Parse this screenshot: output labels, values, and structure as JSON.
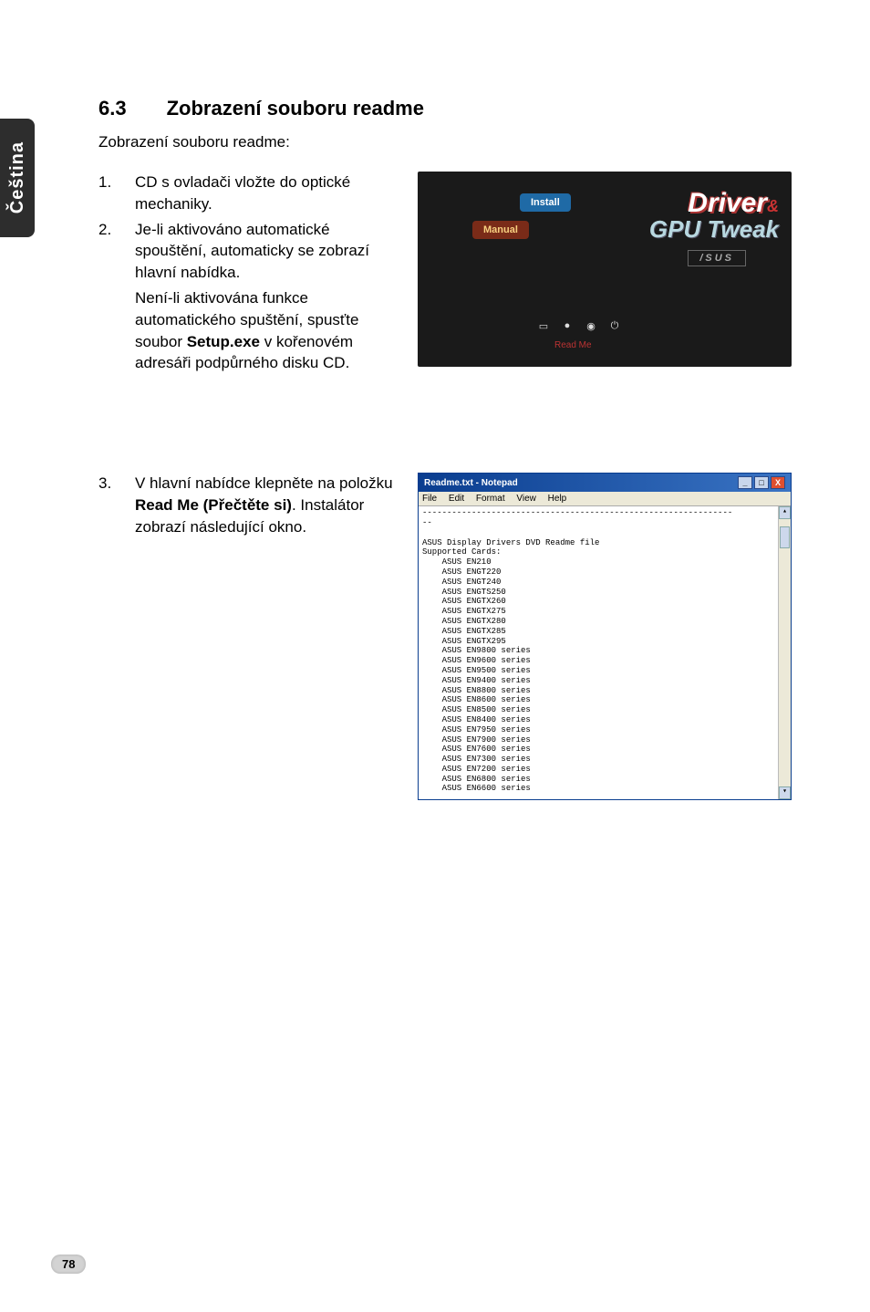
{
  "sidebar": {
    "language": "Čeština"
  },
  "section": {
    "number": "6.3",
    "title": "Zobrazení souboru readme"
  },
  "intro": "Zobrazení souboru readme:",
  "steps": {
    "s1_num": "1.",
    "s1_text": "CD s ovladači vložte do optické mechaniky.",
    "s2_num": "2.",
    "s2_text": "Je-li aktivováno automatické spouštění, automaticky se zobrazí hlavní nabídka.",
    "s2_sub_pre": "Není-li aktivována funkce automatického spuštění, spusťte soubor ",
    "s2_sub_bold": "Setup.exe",
    "s2_sub_post": " v kořenovém adresáři podpůrného disku CD.",
    "s3_num": "3.",
    "s3_pre": "V hlavní nabídce klepněte na položku ",
    "s3_bold": "Read Me (Přečtěte si)",
    "s3_post": ". Instalátor zobrazí následující okno."
  },
  "driver_panel": {
    "tab_install": "Install",
    "tab_manual": "Manual",
    "logo_line1": "Driver",
    "logo_amp": "&",
    "logo_line2": "GPU Tweak",
    "brand": "/SUS",
    "readme": "Read Me"
  },
  "notepad": {
    "title": "Readme.txt - Notepad",
    "menu": [
      "File",
      "Edit",
      "Format",
      "View",
      "Help"
    ],
    "content": "---------------------------------------------------------------\n--\n\nASUS Display Drivers DVD Readme file\nSupported Cards:\n    ASUS EN210\n    ASUS ENGT220\n    ASUS ENGT240\n    ASUS ENGTS250\n    ASUS ENGTX260\n    ASUS ENGTX275\n    ASUS ENGTX280\n    ASUS ENGTX285\n    ASUS ENGTX295\n    ASUS EN9800 series\n    ASUS EN9600 series\n    ASUS EN9500 series\n    ASUS EN9400 series\n    ASUS EN8800 series\n    ASUS EN8600 series\n    ASUS EN8500 series\n    ASUS EN8400 series\n    ASUS EN7950 series\n    ASUS EN7900 series\n    ASUS EN7600 series\n    ASUS EN7300 series\n    ASUS EN7200 series\n    ASUS EN6800 series\n    ASUS EN6600 series"
  },
  "page_number": "78"
}
